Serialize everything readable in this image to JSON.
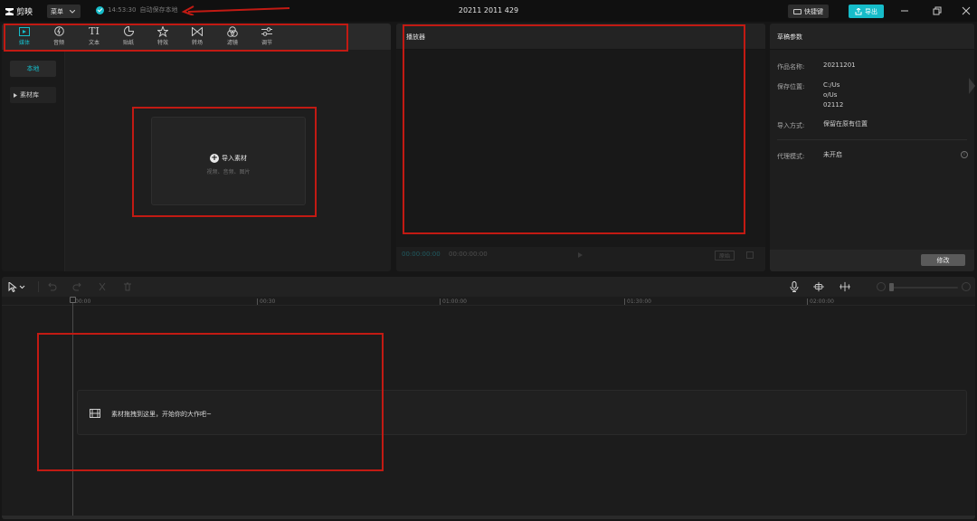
{
  "titlebar": {
    "app_name": "剪映",
    "menu_label": "菜单",
    "save_time": "14:53:30",
    "save_text": "自动保存本地",
    "project_title": "20211 2011 429",
    "shortcut_label": "快捷键",
    "export_label": "导出"
  },
  "toolbar": {
    "tools": [
      {
        "label": "媒体",
        "icon": "media-icon"
      },
      {
        "label": "音频",
        "icon": "audio-icon"
      },
      {
        "label": "文本",
        "icon": "text-icon"
      },
      {
        "label": "贴纸",
        "icon": "sticker-icon"
      },
      {
        "label": "特效",
        "icon": "effects-icon"
      },
      {
        "label": "转场",
        "icon": "transition-icon"
      },
      {
        "label": "滤镜",
        "icon": "filter-icon"
      },
      {
        "label": "调节",
        "icon": "adjust-icon"
      }
    ],
    "active_index": 0
  },
  "media": {
    "sidebar_local": "本地",
    "sidebar_library": "素材库",
    "import_label": "导入素材",
    "import_hint": "视频、音频、图片"
  },
  "player": {
    "title": "播放器",
    "current_time": "00:00:00:00",
    "total_time": "00:00:00:00",
    "ratio_label": "原始"
  },
  "params": {
    "title": "草稿参数",
    "name_label": "作品名称:",
    "name_value": "20211201",
    "path_label": "保存位置:",
    "path_value_1": "C:/Us",
    "path_value_2": "o/Us",
    "path_value_3": "02112",
    "import_label": "导入方式:",
    "import_value": "保留在原有位置",
    "proxy_label": "代理模式:",
    "proxy_value": "未开启",
    "modify_label": "修改"
  },
  "timeline": {
    "ruler": [
      "00:00",
      "00:30",
      "01:00:00",
      "01:30:00",
      "02:00:00"
    ],
    "track_hint": "素材拖拽到这里，开始你的大作吧~"
  },
  "colors": {
    "accent": "#16bcc9",
    "annotation": "#c21a13"
  }
}
